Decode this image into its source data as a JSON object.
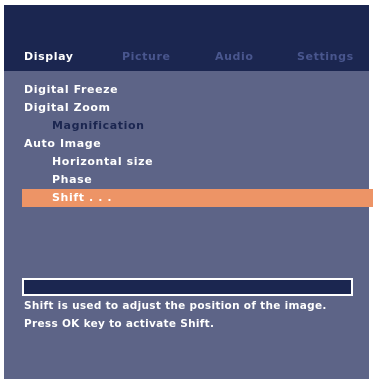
{
  "tabs": [
    {
      "label": "Display",
      "active": true
    },
    {
      "label": "Picture",
      "active": false
    },
    {
      "label": "Audio",
      "active": false
    },
    {
      "label": "Settings",
      "active": false
    }
  ],
  "menu": {
    "items": [
      {
        "label": "Digital Freeze"
      },
      {
        "label": "Digital Zoom"
      },
      {
        "label": "Magnification"
      },
      {
        "label": "Auto Image"
      },
      {
        "label": "Horizontal size"
      },
      {
        "label": "Phase"
      },
      {
        "label": "Shift . . ."
      }
    ]
  },
  "help": {
    "line1": "Shift is used to adjust the position of the image.",
    "line2": "Press OK key to activate Shift."
  },
  "colors": {
    "background": "#5d6487",
    "header_band": "#1b2650",
    "selection": "#ed9466",
    "inactive_tab": "#49568e"
  }
}
